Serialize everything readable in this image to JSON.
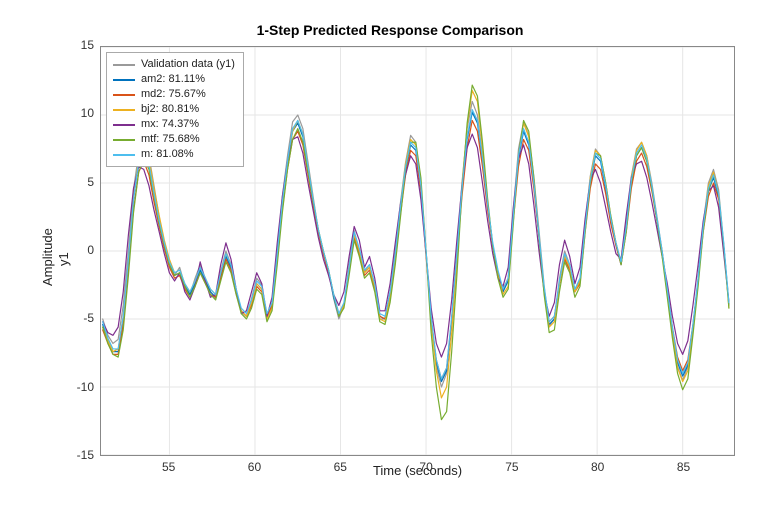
{
  "chart_data": {
    "type": "line",
    "title": "1-Step Predicted Response Comparison",
    "xlabel": "Time (seconds)",
    "ylabel": "Amplitude",
    "ylabel2": "y1",
    "xlim": [
      51,
      88
    ],
    "ylim": [
      -15,
      15
    ],
    "xticks": [
      55,
      60,
      65,
      70,
      75,
      80,
      85
    ],
    "yticks": [
      -15,
      -10,
      -5,
      0,
      5,
      10,
      15
    ],
    "grid": true,
    "legend_position": "upper-left",
    "x": [
      51.1,
      51.4,
      51.7,
      52.0,
      52.3,
      52.6,
      52.9,
      53.2,
      53.5,
      53.8,
      54.1,
      54.4,
      54.7,
      55.0,
      55.3,
      55.6,
      55.9,
      56.2,
      56.5,
      56.8,
      57.1,
      57.4,
      57.7,
      58.0,
      58.3,
      58.6,
      58.9,
      59.2,
      59.5,
      59.8,
      60.1,
      60.4,
      60.7,
      61.0,
      61.3,
      61.6,
      61.9,
      62.2,
      62.5,
      62.8,
      63.1,
      63.4,
      63.7,
      64.0,
      64.3,
      64.6,
      64.9,
      65.2,
      65.5,
      65.8,
      66.1,
      66.4,
      66.7,
      67.0,
      67.3,
      67.6,
      67.9,
      68.2,
      68.5,
      68.8,
      69.1,
      69.4,
      69.7,
      70.0,
      70.3,
      70.6,
      70.9,
      71.2,
      71.5,
      71.8,
      72.1,
      72.4,
      72.7,
      73.0,
      73.3,
      73.6,
      73.9,
      74.2,
      74.5,
      74.8,
      75.1,
      75.4,
      75.7,
      76.0,
      76.3,
      76.6,
      76.9,
      77.2,
      77.5,
      77.8,
      78.1,
      78.4,
      78.7,
      79.0,
      79.3,
      79.6,
      79.9,
      80.2,
      80.5,
      80.8,
      81.1,
      81.4,
      81.7,
      82.0,
      82.3,
      82.6,
      82.9,
      83.2,
      83.5,
      83.8,
      84.1,
      84.4,
      84.7,
      85.0,
      85.3,
      85.6,
      85.9,
      86.2,
      86.5,
      86.8,
      87.1,
      87.4,
      87.7
    ],
    "series": [
      {
        "name": "Validation data (y1)",
        "legend": "Validation data (y1)",
        "color": "#9a9a9a",
        "values": [
          -5.0,
          -6.2,
          -6.8,
          -6.5,
          -4.0,
          0.0,
          4.5,
          7.2,
          8.0,
          7.0,
          4.8,
          2.5,
          0.5,
          -1.0,
          -1.8,
          -1.2,
          -2.5,
          -3.2,
          -2.0,
          -1.0,
          -2.0,
          -3.0,
          -3.5,
          -1.5,
          0.0,
          -1.0,
          -3.0,
          -4.5,
          -4.8,
          -3.5,
          -2.0,
          -2.5,
          -5.0,
          -4.0,
          0.0,
          4.0,
          7.0,
          9.5,
          10.0,
          9.0,
          6.5,
          4.0,
          1.5,
          0.0,
          -1.5,
          -3.5,
          -5.0,
          -4.0,
          -1.0,
          1.5,
          0.0,
          -1.5,
          -1.0,
          -2.5,
          -5.0,
          -5.0,
          -3.0,
          0.0,
          3.5,
          6.5,
          8.5,
          8.0,
          5.0,
          0.0,
          -5.0,
          -8.5,
          -10.0,
          -9.0,
          -5.0,
          0.0,
          5.0,
          9.0,
          11.0,
          10.0,
          7.0,
          3.5,
          0.5,
          -1.5,
          -3.0,
          -2.0,
          3.0,
          7.5,
          9.5,
          8.5,
          5.5,
          1.5,
          -2.5,
          -5.5,
          -5.0,
          -2.0,
          0.0,
          -1.0,
          -3.0,
          -2.0,
          2.0,
          5.5,
          7.5,
          7.0,
          5.0,
          2.5,
          0.5,
          -1.0,
          2.0,
          5.5,
          7.5,
          8.0,
          7.0,
          5.0,
          2.5,
          0.0,
          -3.0,
          -6.0,
          -8.5,
          -9.5,
          -8.5,
          -5.5,
          -2.0,
          2.0,
          5.0,
          6.0,
          4.5,
          0.5,
          -4.0
        ]
      },
      {
        "name": "am2",
        "legend": "am2: 81.11%",
        "color": "#0072bd",
        "values": [
          -5.4,
          -6.6,
          -7.4,
          -7.4,
          -5.0,
          -0.8,
          3.8,
          6.6,
          7.4,
          6.4,
          4.2,
          2.2,
          0.4,
          -1.0,
          -1.8,
          -1.6,
          -2.6,
          -3.2,
          -2.4,
          -1.4,
          -2.2,
          -3.0,
          -3.4,
          -1.8,
          -0.4,
          -1.2,
          -3.0,
          -4.4,
          -4.8,
          -3.8,
          -2.4,
          -2.8,
          -4.8,
          -4.0,
          -0.4,
          3.4,
          6.4,
          8.8,
          9.4,
          8.4,
          6.0,
          3.6,
          1.4,
          -0.2,
          -1.6,
          -3.4,
          -4.8,
          -4.0,
          -1.4,
          1.2,
          0.0,
          -1.6,
          -1.2,
          -2.6,
          -4.8,
          -5.0,
          -3.2,
          -0.4,
          3.0,
          6.0,
          7.8,
          7.4,
          4.6,
          -0.2,
          -5.0,
          -8.2,
          -9.6,
          -8.8,
          -5.0,
          -0.4,
          4.4,
          8.2,
          10.2,
          9.4,
          6.6,
          3.2,
          0.4,
          -1.6,
          -3.0,
          -2.2,
          2.4,
          6.8,
          8.8,
          7.8,
          4.8,
          1.0,
          -2.8,
          -5.4,
          -5.0,
          -2.4,
          -0.4,
          -1.2,
          -3.0,
          -2.2,
          1.6,
          5.0,
          7.0,
          6.6,
          4.6,
          2.2,
          0.4,
          -1.0,
          1.6,
          5.0,
          7.0,
          7.6,
          6.6,
          4.6,
          2.2,
          -0.2,
          -3.0,
          -5.8,
          -8.2,
          -9.2,
          -8.4,
          -5.6,
          -2.2,
          1.6,
          4.4,
          5.4,
          4.0,
          0.4,
          -4.0
        ]
      },
      {
        "name": "md2",
        "legend": "md2: 75.67%",
        "color": "#d95319",
        "values": [
          -5.8,
          -6.8,
          -7.6,
          -7.6,
          -5.4,
          -1.4,
          3.0,
          5.8,
          6.6,
          5.6,
          3.6,
          1.8,
          0.2,
          -1.2,
          -2.0,
          -1.8,
          -2.8,
          -3.4,
          -2.6,
          -1.6,
          -2.4,
          -3.2,
          -3.4,
          -2.0,
          -0.6,
          -1.4,
          -3.2,
          -4.4,
          -4.8,
          -4.0,
          -2.6,
          -3.0,
          -4.8,
          -4.0,
          -0.6,
          3.0,
          6.0,
          8.2,
          8.8,
          7.8,
          5.6,
          3.4,
          1.4,
          -0.2,
          -1.6,
          -3.2,
          -4.6,
          -4.0,
          -1.6,
          1.0,
          -0.2,
          -1.8,
          -1.4,
          -2.8,
          -4.8,
          -5.0,
          -3.4,
          -0.6,
          2.6,
          5.6,
          7.4,
          7.0,
          4.4,
          -0.4,
          -5.0,
          -8.0,
          -9.4,
          -8.6,
          -5.0,
          -0.6,
          4.0,
          7.6,
          9.6,
          8.8,
          6.2,
          3.0,
          0.4,
          -1.6,
          -2.8,
          -2.0,
          2.2,
          6.2,
          8.2,
          7.4,
          4.6,
          1.0,
          -2.8,
          -5.2,
          -4.8,
          -2.4,
          -0.6,
          -1.4,
          -3.0,
          -2.4,
          1.4,
          4.6,
          6.4,
          6.0,
          4.2,
          2.0,
          0.4,
          -1.0,
          1.4,
          4.6,
          6.6,
          7.2,
          6.2,
          4.4,
          2.2,
          0.0,
          -2.8,
          -5.6,
          -7.8,
          -8.8,
          -8.0,
          -5.4,
          -2.2,
          1.4,
          4.0,
          5.0,
          3.8,
          0.4,
          -3.8
        ]
      },
      {
        "name": "bj2",
        "legend": "bj2: 80.81%",
        "color": "#edb120",
        "values": [
          -5.6,
          -6.6,
          -7.4,
          -7.2,
          -4.8,
          -0.6,
          4.0,
          6.8,
          7.6,
          6.8,
          4.6,
          2.6,
          0.8,
          -0.6,
          -1.6,
          -1.4,
          -2.4,
          -3.0,
          -2.2,
          -1.2,
          -2.0,
          -2.8,
          -3.2,
          -1.6,
          -0.2,
          -1.0,
          -2.8,
          -4.4,
          -4.8,
          -3.8,
          -2.4,
          -2.8,
          -5.0,
          -4.2,
          -0.6,
          3.4,
          6.4,
          8.8,
          9.6,
          8.6,
          6.2,
          3.8,
          1.6,
          0.0,
          -1.4,
          -3.2,
          -4.8,
          -4.0,
          -1.2,
          1.2,
          0.0,
          -1.6,
          -1.2,
          -2.6,
          -5.0,
          -5.2,
          -3.4,
          -0.4,
          3.2,
          6.4,
          8.2,
          7.8,
          5.0,
          0.0,
          -5.2,
          -8.8,
          -10.8,
          -10.0,
          -6.0,
          -0.8,
          4.8,
          9.2,
          11.8,
          11.0,
          7.6,
          3.6,
          0.4,
          -1.8,
          -3.2,
          -2.6,
          2.2,
          7.0,
          9.4,
          8.4,
          5.2,
          1.2,
          -2.8,
          -5.6,
          -5.2,
          -2.4,
          -0.4,
          -1.2,
          -3.0,
          -2.2,
          1.8,
          5.4,
          7.4,
          7.0,
          5.0,
          2.6,
          0.6,
          -0.8,
          1.8,
          5.4,
          7.4,
          8.0,
          7.0,
          4.8,
          2.4,
          -0.2,
          -3.2,
          -6.0,
          -8.6,
          -9.6,
          -8.8,
          -5.8,
          -2.2,
          1.8,
          4.8,
          5.8,
          4.2,
          0.4,
          -4.2
        ]
      },
      {
        "name": "mx",
        "legend": "mx: 74.37%",
        "color": "#7e2f8e",
        "values": [
          -5.2,
          -6.0,
          -6.2,
          -5.6,
          -3.0,
          1.2,
          4.6,
          6.2,
          6.0,
          4.8,
          3.0,
          1.4,
          -0.2,
          -1.6,
          -2.2,
          -1.6,
          -3.0,
          -3.6,
          -2.6,
          -0.8,
          -2.2,
          -3.4,
          -3.2,
          -1.0,
          0.6,
          -0.6,
          -2.8,
          -4.6,
          -4.4,
          -3.0,
          -1.6,
          -2.4,
          -4.8,
          -3.4,
          0.6,
          4.0,
          6.6,
          8.2,
          8.4,
          7.2,
          5.0,
          3.0,
          1.0,
          -0.6,
          -1.8,
          -3.2,
          -4.0,
          -3.0,
          -0.4,
          1.8,
          0.8,
          -1.2,
          -0.4,
          -2.0,
          -4.4,
          -4.4,
          -2.4,
          0.6,
          3.4,
          5.6,
          7.0,
          6.4,
          3.8,
          -0.2,
          -4.2,
          -6.8,
          -7.8,
          -6.8,
          -3.6,
          0.8,
          4.8,
          7.6,
          8.6,
          7.6,
          5.0,
          2.2,
          -0.2,
          -2.0,
          -2.6,
          -1.2,
          3.2,
          6.8,
          7.8,
          6.4,
          3.4,
          0.0,
          -3.0,
          -4.8,
          -3.8,
          -1.0,
          0.8,
          -0.4,
          -2.4,
          -1.2,
          2.4,
          5.2,
          6.0,
          5.0,
          3.2,
          1.4,
          -0.2,
          -0.6,
          2.6,
          5.4,
          6.4,
          6.6,
          5.4,
          3.6,
          1.6,
          -0.4,
          -2.4,
          -4.8,
          -6.8,
          -7.6,
          -6.6,
          -4.0,
          -1.0,
          2.2,
          4.4,
          4.8,
          3.2,
          -0.2,
          -3.8
        ]
      },
      {
        "name": "mtf",
        "legend": "mtf: 75.68%",
        "color": "#77ac30",
        "values": [
          -5.6,
          -6.8,
          -7.6,
          -7.8,
          -5.8,
          -1.8,
          2.8,
          5.8,
          6.8,
          6.0,
          4.0,
          2.0,
          0.4,
          -1.0,
          -1.8,
          -1.6,
          -2.6,
          -3.4,
          -2.6,
          -1.6,
          -2.4,
          -3.2,
          -3.6,
          -2.2,
          -0.8,
          -1.6,
          -3.2,
          -4.6,
          -5.0,
          -4.2,
          -2.8,
          -3.2,
          -5.2,
          -4.4,
          -1.0,
          2.8,
          6.0,
          8.2,
          9.0,
          8.0,
          5.8,
          3.6,
          1.6,
          0.0,
          -1.4,
          -3.2,
          -4.8,
          -4.2,
          -1.8,
          0.8,
          -0.4,
          -2.0,
          -1.6,
          -3.0,
          -5.2,
          -5.4,
          -3.8,
          -1.0,
          2.4,
          6.0,
          8.0,
          8.0,
          5.4,
          0.0,
          -6.0,
          -10.0,
          -12.4,
          -11.8,
          -7.4,
          -1.8,
          4.4,
          9.4,
          12.2,
          11.4,
          8.0,
          3.8,
          0.4,
          -2.0,
          -3.4,
          -2.8,
          2.0,
          7.0,
          9.6,
          8.8,
          5.4,
          1.0,
          -3.2,
          -6.0,
          -5.8,
          -3.0,
          -0.8,
          -1.6,
          -3.4,
          -2.6,
          1.4,
          5.0,
          7.2,
          7.0,
          5.0,
          2.6,
          0.6,
          -1.0,
          1.4,
          5.0,
          7.0,
          7.6,
          6.6,
          4.6,
          2.2,
          -0.4,
          -3.4,
          -6.4,
          -9.0,
          -10.2,
          -9.4,
          -6.2,
          -2.6,
          1.4,
          4.4,
          5.6,
          4.2,
          0.4,
          -4.2
        ]
      },
      {
        "name": "m",
        "legend": "m: 81.08%",
        "color": "#4dbeee",
        "values": [
          -5.2,
          -6.4,
          -7.2,
          -7.2,
          -4.8,
          -0.6,
          3.8,
          6.6,
          7.4,
          6.4,
          4.2,
          2.2,
          0.6,
          -0.8,
          -1.6,
          -1.4,
          -2.4,
          -3.0,
          -2.2,
          -1.2,
          -2.0,
          -2.8,
          -3.2,
          -1.6,
          -0.2,
          -1.0,
          -2.8,
          -4.2,
          -4.6,
          -3.6,
          -2.2,
          -2.6,
          -4.6,
          -3.8,
          -0.2,
          3.6,
          6.6,
          9.0,
          9.6,
          8.6,
          6.2,
          3.8,
          1.6,
          0.0,
          -1.4,
          -3.2,
          -4.6,
          -3.8,
          -1.2,
          1.4,
          0.2,
          -1.4,
          -1.0,
          -2.4,
          -4.6,
          -4.8,
          -3.0,
          -0.2,
          3.2,
          6.2,
          8.0,
          7.6,
          4.8,
          0.0,
          -4.8,
          -8.0,
          -9.4,
          -8.6,
          -4.8,
          -0.2,
          4.6,
          8.4,
          10.4,
          9.6,
          6.8,
          3.4,
          0.6,
          -1.4,
          -2.8,
          -2.0,
          2.6,
          7.0,
          9.0,
          8.0,
          5.0,
          1.2,
          -2.6,
          -5.2,
          -4.8,
          -2.2,
          -0.2,
          -1.0,
          -2.8,
          -2.0,
          1.8,
          5.2,
          7.2,
          6.8,
          4.8,
          2.4,
          0.6,
          -0.8,
          1.8,
          5.2,
          7.2,
          7.8,
          6.8,
          4.8,
          2.4,
          0.0,
          -2.8,
          -5.6,
          -8.0,
          -9.0,
          -8.2,
          -5.4,
          -2.0,
          1.8,
          4.6,
          5.6,
          4.2,
          0.6,
          -3.8
        ]
      }
    ]
  }
}
